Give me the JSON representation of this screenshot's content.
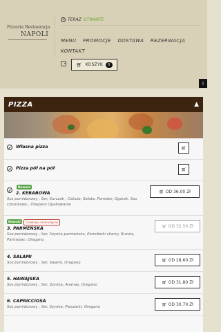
{
  "header": {
    "logo": {
      "line1": "Pizzeria Restauracja",
      "line2": "NAPOLI"
    },
    "status": {
      "label": "TERAZ",
      "value": "OTWARTE"
    },
    "nav": [
      "MENU",
      "PROMOCJE",
      "DOSTAWA",
      "REZERWACJA",
      "KONTAKT"
    ],
    "cart": {
      "label": "KOSZYK",
      "count": "0"
    }
  },
  "panel": {
    "title": "PIZZA",
    "items": [
      {
        "title": "Własna pizza"
      },
      {
        "title": "Pizza pół na pół"
      },
      {
        "title": "2. KEBABOWA",
        "badge": "Nowość",
        "desc": "Sos pomidorowy , Ser, Kurczak , Cebula, Sałata, Pomidor, Ogórek, Sos czosnkowy , Oregano Opakowanie",
        "price": "OD 36,00 Zł"
      },
      {
        "title": "3. PARMEŃSKA",
        "badge": "Nowość",
        "badge2": "Chwilowo niedostępne",
        "desc": "Sos pomidorowy , Ser, Szynka parmeńska, Pomidorki cherry, Rucola, Parmezan, Oregano",
        "price": "OD 32,50 Zł"
      },
      {
        "title": "4. SALAMI",
        "desc": "Sos pomidorowy , Ser, Salami, Oregano",
        "price": "OD 28,60 Zł"
      },
      {
        "title": "5. HAWAJSKA",
        "desc": "Sos pomidorowy , Ser, Szynka, Ananas, Oregano",
        "price": "OD 31,80 Zł"
      },
      {
        "title": "6. CAPRICCIOSA",
        "desc": "Sos pomidorowy , Ser, Szynka, Pieczarki, Oregano",
        "price": "OD 30,70 Zł"
      }
    ]
  },
  "icons": {
    "info": "info-icon",
    "cart": "cart-icon",
    "chevron": "chevron-up-icon"
  },
  "colors": {
    "panel_header": "#3d2410",
    "status_open": "#6aa233",
    "badge_new": "#5aa247",
    "badge_unavailable": "#c0392b"
  }
}
